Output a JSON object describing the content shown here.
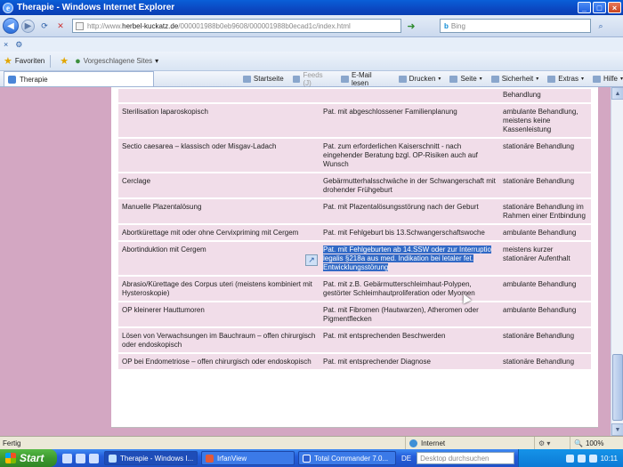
{
  "window": {
    "title": "Therapie - Windows Internet Explorer",
    "min": "_",
    "max": "□",
    "close": "×"
  },
  "address": {
    "url_prefix": "http://www.",
    "url_domain": "herbel-kuckatz.de",
    "url_path": "/000001988b0eb9608/000001988b0ecad1c/index.html",
    "search_placeholder": "Bing",
    "search_brand": "b"
  },
  "links": {
    "close_glyph": "×",
    "fav_glyph": "⚙"
  },
  "favorites_bar": {
    "favorites_label": "Favoriten",
    "suggested_label": "Vorgeschlagene Sites",
    "suggested_arrow": "▾"
  },
  "tab": {
    "label": "Therapie"
  },
  "commands": [
    {
      "label": "Startseite",
      "disabled": false
    },
    {
      "label": "Feeds (J)",
      "disabled": true
    },
    {
      "label": "E-Mail lesen",
      "disabled": false
    },
    {
      "label": "Drucken",
      "disabled": false
    },
    {
      "label": "Seite",
      "disabled": false
    },
    {
      "label": "Sicherheit",
      "disabled": false
    },
    {
      "label": "Extras",
      "disabled": false
    },
    {
      "label": "Hilfe",
      "disabled": false
    }
  ],
  "table": {
    "first_row_tail": "Behandlung",
    "rows": [
      {
        "c1": "Sterilisation laparoskopisch",
        "c2": "Pat. mit abgeschlossener Familienplanung",
        "c3": "ambulante Behandlung, meistens keine Kassenleistung"
      },
      {
        "c1": "Sectio caesarea – klassisch oder Misgav-Ladach",
        "c2": "Pat. zum erforderlichen Kaiserschnitt - nach eingehender Beratung bzgl. OP-Risiken auch auf Wunsch",
        "c3": "stationäre Behandlung"
      },
      {
        "c1": "Cerclage",
        "c2": "Gebärmutterhalsschwäche in der Schwangerschaft mit drohender Frühgeburt",
        "c3": "stationäre Behandlung"
      },
      {
        "c1": "Manuelle Plazentalösung",
        "c2": "Pat. mit Plazentalösungsstörung nach der Geburt",
        "c3": "stationäre Behandlung im Rahmen einer Entbindung"
      },
      {
        "c1": "Abortkürettage mit oder ohne Cervixpriming mit Cergem",
        "c2": "Pat. mit Fehlgeburt bis 13.Schwangerschaftswoche",
        "c3": "ambulante Behandlung"
      },
      {
        "c1": "Abortinduktion mit Cergem",
        "c2": "Pat. mit Fehlgeburten ab 14.SSW oder zur Interruptio legalis §218a aus med. Indikation bei letaler fet. Entwicklungsstörung",
        "c3": "meistens kurzer stationärer Aufenthalt",
        "highlight": true
      },
      {
        "c1": "Abrasio/Kürettage des Corpus uteri (meistens kombiniert mit Hysteroskopie)",
        "c2": "Pat. mit z.B. Gebärmutterschleimhaut-Polypen, gestörter Schleimhautproliferation oder Myomen",
        "c3": "ambulante Behandlung"
      },
      {
        "c1": "OP kleinerer Hauttumoren",
        "c2": "Pat. mit Fibromen (Hautwarzen), Atheromen oder Pigmentflecken",
        "c3": "ambulante Behandlung"
      },
      {
        "c1": "Lösen von Verwachsungen im Bauchraum – offen chirurgisch oder endoskopisch",
        "c2": "Pat. mit entsprechenden Beschwerden",
        "c3": "stationäre Behandlung"
      },
      {
        "c1": "OP bei Endometriose – offen chirurgisch oder endoskopisch",
        "c2": "Pat. mit entsprechender Diagnose",
        "c3": "stationäre Behandlung"
      }
    ]
  },
  "statusbar": {
    "status": "Fertig",
    "zone": "Internet",
    "zoom": "100%"
  },
  "taskbar": {
    "start_label": "Start",
    "tasks": [
      {
        "label": "Therapie - Windows I...",
        "active": true
      },
      {
        "label": "IrfanView",
        "active": false
      },
      {
        "label": "Total Commander 7.0...",
        "active": false
      }
    ],
    "lang": "DE",
    "desktop_search_placeholder": "Desktop durchsuchen",
    "clock": "10:11"
  }
}
